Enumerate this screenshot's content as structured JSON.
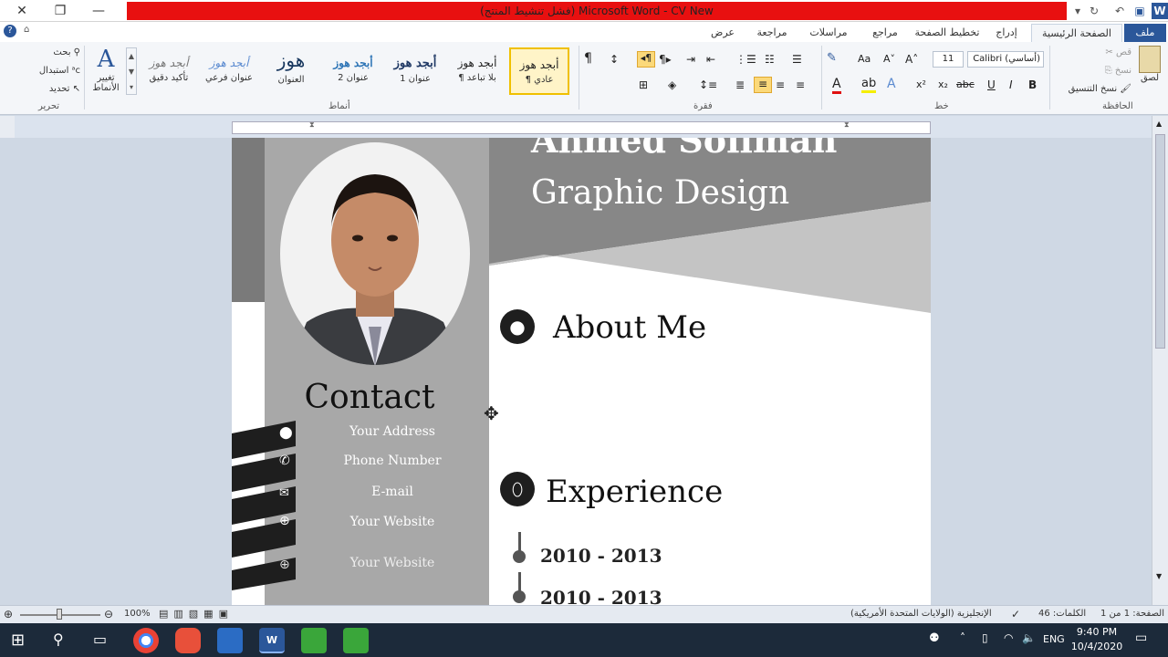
{
  "window": {
    "title": "(فشل تنشيط المنتج) Microsoft Word - CV New"
  },
  "tabs": [
    "ملف",
    "الصفحة الرئيسية",
    "إدراج",
    "تخطيط الصفحة",
    "مراجع",
    "مراسلات",
    "مراجعة",
    "عرض"
  ],
  "ribbon": {
    "clipboard": {
      "paste": "لصق",
      "cut": "قص",
      "copy": "نسخ",
      "format_painter": "نسخ التنسيق",
      "label": "الحافظة"
    },
    "font": {
      "name": "Calibri (أساسي)",
      "size": "11",
      "label": "خط",
      "bold": "B",
      "italic": "I",
      "underline": "U"
    },
    "paragraph": {
      "label": "فقرة"
    },
    "styles": {
      "label": "أنماط",
      "items": [
        {
          "preview": "أبجد هوز",
          "name": "¶ عادي"
        },
        {
          "preview": "أبجد هوز",
          "name": "¶ بلا تباعد"
        },
        {
          "preview": "أبجد هوز",
          "name": "عنوان 1"
        },
        {
          "preview": "أبجد هوز",
          "name": "عنوان 2"
        },
        {
          "preview": "هوز",
          "name": "العنوان"
        },
        {
          "preview": "أبجد هوز",
          "name": "عنوان فرعي"
        },
        {
          "preview": "أبجد هوز",
          "name": "تأكيد دقيق"
        }
      ],
      "change_styles": "تغيير الأنماط"
    },
    "editing": {
      "find": "بحث",
      "replace": "استبدال",
      "select": "تحديد",
      "label": "تحرير"
    }
  },
  "document": {
    "name": "Ahmed Soliman",
    "job": "Graphic Design",
    "about_heading": "About Me",
    "contact_heading": "Contact",
    "contact_items": [
      "Your Address",
      "Phone Number",
      "E-mail",
      "Your Website",
      "Your Website"
    ],
    "experience_heading": "Experience",
    "experience_items": [
      "2010 - 2013",
      "2010 - 2013"
    ]
  },
  "status": {
    "page": "الصفحة: 1 من 1",
    "words": "الكلمات: 46",
    "language": "الإنجليزية (الولايات المتحدة الأمريكية)",
    "zoom": "100%"
  },
  "taskbar": {
    "lang": "ENG",
    "time": "9:40 PM",
    "date": "10/4/2020"
  },
  "colors": {
    "title_red": "#e81010",
    "word_blue": "#2b579a",
    "panel_gray": "#9b9b9b",
    "dark_gray": "#7a7a7a",
    "icon_black": "#1e1e1e"
  }
}
